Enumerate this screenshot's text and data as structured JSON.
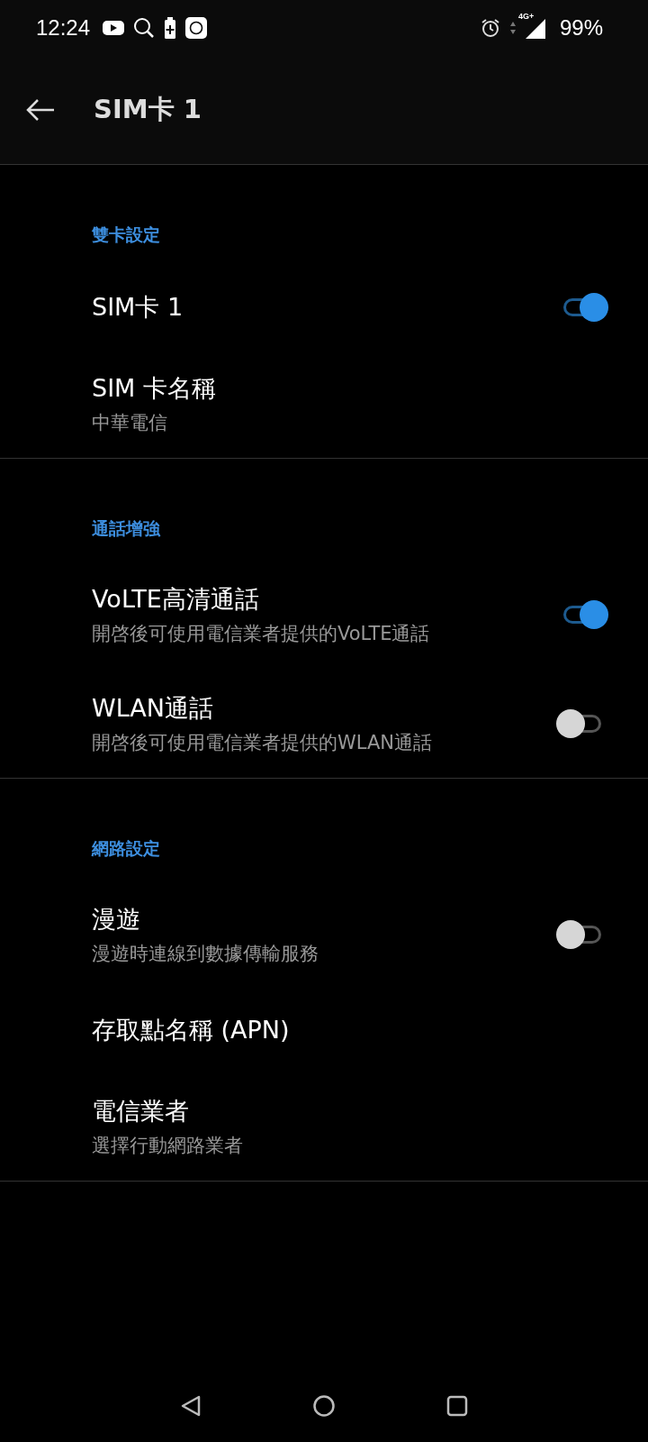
{
  "status_bar": {
    "time": "12:24",
    "network_type": "4G+",
    "battery": "99%"
  },
  "toolbar": {
    "title": "SIM卡 1"
  },
  "sections": [
    {
      "header": "雙卡設定",
      "items": [
        {
          "kind": "switch",
          "title": "SIM卡 1",
          "on": true
        },
        {
          "kind": "plain",
          "title": "SIM 卡名稱",
          "summary": "中華電信"
        }
      ]
    },
    {
      "header": "通話增強",
      "items": [
        {
          "kind": "switch",
          "title": "VoLTE高清通話",
          "summary": "開啓後可使用電信業者提供的VoLTE通話",
          "on": true
        },
        {
          "kind": "switch",
          "title": "WLAN通話",
          "summary": "開啓後可使用電信業者提供的WLAN通話",
          "on": false
        }
      ]
    },
    {
      "header": "網路設定",
      "items": [
        {
          "kind": "switch",
          "title": "漫遊",
          "summary": "漫遊時連線到數據傳輸服務",
          "on": false
        },
        {
          "kind": "plain",
          "title": "存取點名稱 (APN)"
        },
        {
          "kind": "plain",
          "title": "電信業者",
          "summary": "選擇行動網路業者"
        }
      ]
    }
  ]
}
